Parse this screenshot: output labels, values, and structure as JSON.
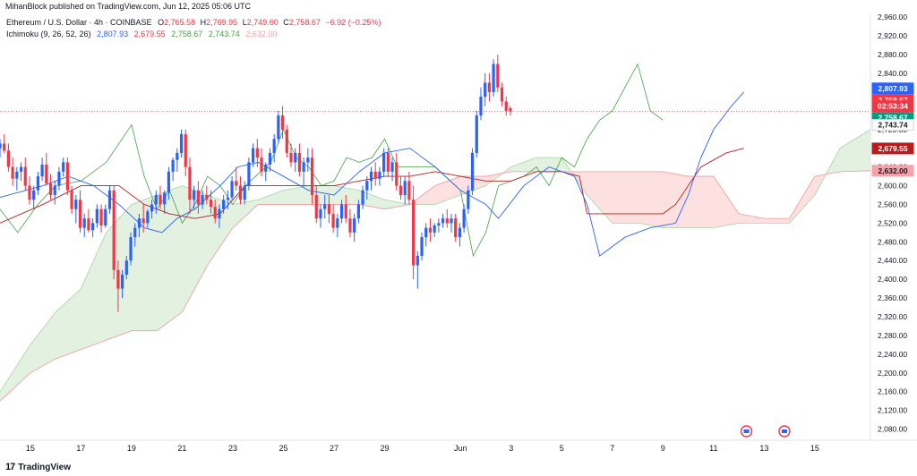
{
  "header": {
    "publisher": "MihanBlock published on TradingView.com, Jun 12, 2025 05:06 UTC"
  },
  "legend": {
    "symbol": "Ethereum / U.S. Dollar · 4h · COINBASE",
    "o_label": "O",
    "o_value": "2,765.58",
    "h_label": "H",
    "h_value": "2,769.95",
    "l_label": "L",
    "l_value": "2,749.60",
    "c_label": "C",
    "c_value": "2,758.67",
    "change": "−6.92 (−0.25%)",
    "ichimoku_label": "Ichimoku (9, 26, 52, 26)",
    "ichimoku_values": [
      "2,807.93",
      "2,679.55",
      "2,758.67",
      "2,743.74",
      "2,632.00"
    ]
  },
  "footer": {
    "brand": "TradingView"
  },
  "colors": {
    "up": "#2962ff",
    "down": "#f23645",
    "conversion": "#2962ff",
    "base": "#b71c1c",
    "lagging": "#43a047",
    "cloud_bull": "#e2f1e0",
    "cloud_bear": "#fce1e0"
  },
  "chart_data": {
    "type": "candlestick",
    "timeframe": "4h",
    "y_axis": {
      "min": 2060,
      "max": 2970,
      "ticks": [
        "2,080.00",
        "2,120.00",
        "2,160.00",
        "2,200.00",
        "2,240.00",
        "2,280.00",
        "2,320.00",
        "2,360.00",
        "2,400.00",
        "2,440.00",
        "2,480.00",
        "2,520.00",
        "2,560.00",
        "2,600.00",
        "2,640.00",
        "2,680.00",
        "2,720.00",
        "2,760.00",
        "2,800.00",
        "2,840.00",
        "2,880.00",
        "2,920.00",
        "2,960.00"
      ],
      "tick_values": [
        2080,
        2120,
        2160,
        2200,
        2240,
        2280,
        2320,
        2360,
        2400,
        2440,
        2480,
        2520,
        2560,
        2600,
        2640,
        2680,
        2720,
        2760,
        2800,
        2840,
        2880,
        2920,
        2960
      ]
    },
    "x_axis": {
      "labels": [
        "15",
        "17",
        "19",
        "21",
        "23",
        "25",
        "27",
        "29",
        "Jun",
        "3",
        "5",
        "7",
        "9",
        "11",
        "13",
        "15"
      ],
      "label_days": [
        0,
        2,
        4,
        6,
        8,
        10,
        12,
        14,
        17,
        19,
        21,
        23,
        25,
        27,
        29,
        31
      ],
      "start_day": -1.2,
      "end_day": 33.2
    },
    "price_tags": [
      {
        "text": "2,807.93",
        "value": 2807.93,
        "color": "#2962ff"
      },
      {
        "text": "2,758.67",
        "value": 2783,
        "color": "#f23645"
      },
      {
        "text": "02:53:34",
        "value": 2770,
        "color": "#f23645"
      },
      {
        "text": "2,758.67",
        "value": 2745,
        "color": "#089981"
      },
      {
        "text": "2,743.74",
        "value": 2730,
        "color": "#ffffff",
        "text_color": "#131722"
      },
      {
        "text": "2,679.55",
        "value": 2679.55,
        "color": "#b71c1c"
      },
      {
        "text": "2,632.00",
        "value": 2632,
        "color": "#f7a1a8",
        "text_color": "#131722"
      }
    ],
    "last_price": 2758.67,
    "candles_start_day": -1.2,
    "candles_step": 0.1667,
    "candles": [
      [
        2680,
        2700,
        2660,
        2690
      ],
      [
        2690,
        2710,
        2670,
        2675
      ],
      [
        2675,
        2690,
        2630,
        2640
      ],
      [
        2640,
        2660,
        2600,
        2615
      ],
      [
        2615,
        2640,
        2590,
        2630
      ],
      [
        2630,
        2650,
        2610,
        2640
      ],
      [
        2640,
        2660,
        2590,
        2600
      ],
      [
        2600,
        2620,
        2560,
        2570
      ],
      [
        2570,
        2600,
        2550,
        2590
      ],
      [
        2590,
        2630,
        2580,
        2620
      ],
      [
        2620,
        2660,
        2610,
        2645
      ],
      [
        2645,
        2670,
        2600,
        2605
      ],
      [
        2605,
        2625,
        2570,
        2580
      ],
      [
        2580,
        2610,
        2560,
        2600
      ],
      [
        2600,
        2640,
        2590,
        2630
      ],
      [
        2630,
        2660,
        2620,
        2650
      ],
      [
        2650,
        2660,
        2580,
        2590
      ],
      [
        2590,
        2600,
        2540,
        2550
      ],
      [
        2550,
        2580,
        2520,
        2570
      ],
      [
        2570,
        2590,
        2500,
        2510
      ],
      [
        2510,
        2540,
        2490,
        2530
      ],
      [
        2530,
        2550,
        2500,
        2505
      ],
      [
        2505,
        2530,
        2490,
        2520
      ],
      [
        2520,
        2560,
        2510,
        2550
      ],
      [
        2550,
        2560,
        2500,
        2515
      ],
      [
        2515,
        2560,
        2510,
        2550
      ],
      [
        2550,
        2600,
        2540,
        2590
      ],
      [
        2590,
        2600,
        2400,
        2420
      ],
      [
        2420,
        2440,
        2330,
        2380
      ],
      [
        2380,
        2420,
        2360,
        2410
      ],
      [
        2410,
        2450,
        2400,
        2440
      ],
      [
        2440,
        2500,
        2430,
        2490
      ],
      [
        2490,
        2520,
        2470,
        2510
      ],
      [
        2510,
        2540,
        2490,
        2530
      ],
      [
        2530,
        2560,
        2500,
        2520
      ],
      [
        2520,
        2550,
        2510,
        2545
      ],
      [
        2545,
        2570,
        2530,
        2560
      ],
      [
        2560,
        2590,
        2540,
        2580
      ],
      [
        2580,
        2600,
        2550,
        2560
      ],
      [
        2560,
        2590,
        2540,
        2585
      ],
      [
        2585,
        2640,
        2570,
        2630
      ],
      [
        2630,
        2660,
        2610,
        2655
      ],
      [
        2655,
        2680,
        2630,
        2670
      ],
      [
        2670,
        2720,
        2660,
        2710
      ],
      [
        2710,
        2720,
        2620,
        2640
      ],
      [
        2640,
        2660,
        2540,
        2570
      ],
      [
        2570,
        2600,
        2550,
        2590
      ],
      [
        2590,
        2610,
        2540,
        2560
      ],
      [
        2560,
        2590,
        2550,
        2580
      ],
      [
        2580,
        2600,
        2560,
        2570
      ],
      [
        2570,
        2590,
        2540,
        2555
      ],
      [
        2555,
        2570,
        2520,
        2530
      ],
      [
        2530,
        2560,
        2510,
        2550
      ],
      [
        2550,
        2580,
        2540,
        2570
      ],
      [
        2570,
        2590,
        2550,
        2575
      ],
      [
        2575,
        2620,
        2570,
        2610
      ],
      [
        2610,
        2640,
        2590,
        2600
      ],
      [
        2600,
        2620,
        2560,
        2570
      ],
      [
        2570,
        2610,
        2560,
        2600
      ],
      [
        2600,
        2660,
        2590,
        2650
      ],
      [
        2650,
        2690,
        2640,
        2680
      ],
      [
        2680,
        2700,
        2640,
        2660
      ],
      [
        2660,
        2680,
        2620,
        2630
      ],
      [
        2630,
        2650,
        2610,
        2645
      ],
      [
        2645,
        2680,
        2630,
        2670
      ],
      [
        2670,
        2710,
        2650,
        2700
      ],
      [
        2700,
        2760,
        2690,
        2750
      ],
      [
        2750,
        2770,
        2700,
        2720
      ],
      [
        2720,
        2730,
        2660,
        2670
      ],
      [
        2670,
        2690,
        2640,
        2650
      ],
      [
        2650,
        2680,
        2630,
        2670
      ],
      [
        2670,
        2690,
        2620,
        2630
      ],
      [
        2630,
        2660,
        2600,
        2650
      ],
      [
        2650,
        2680,
        2630,
        2660
      ],
      [
        2660,
        2680,
        2560,
        2580
      ],
      [
        2580,
        2600,
        2520,
        2530
      ],
      [
        2530,
        2560,
        2510,
        2550
      ],
      [
        2550,
        2580,
        2530,
        2560
      ],
      [
        2560,
        2580,
        2520,
        2540
      ],
      [
        2540,
        2560,
        2500,
        2510
      ],
      [
        2510,
        2540,
        2490,
        2530
      ],
      [
        2530,
        2570,
        2520,
        2560
      ],
      [
        2560,
        2580,
        2520,
        2530
      ],
      [
        2530,
        2550,
        2490,
        2500
      ],
      [
        2500,
        2540,
        2480,
        2530
      ],
      [
        2530,
        2570,
        2520,
        2560
      ],
      [
        2560,
        2600,
        2550,
        2590
      ],
      [
        2590,
        2620,
        2570,
        2610
      ],
      [
        2610,
        2640,
        2590,
        2630
      ],
      [
        2630,
        2650,
        2600,
        2615
      ],
      [
        2615,
        2640,
        2600,
        2630
      ],
      [
        2630,
        2680,
        2620,
        2670
      ],
      [
        2670,
        2680,
        2620,
        2630
      ],
      [
        2630,
        2660,
        2610,
        2650
      ],
      [
        2650,
        2670,
        2590,
        2600
      ],
      [
        2600,
        2620,
        2570,
        2580
      ],
      [
        2580,
        2620,
        2560,
        2610
      ],
      [
        2610,
        2630,
        2560,
        2570
      ],
      [
        2570,
        2600,
        2400,
        2430
      ],
      [
        2430,
        2460,
        2380,
        2450
      ],
      [
        2450,
        2500,
        2440,
        2490
      ],
      [
        2490,
        2520,
        2470,
        2510
      ],
      [
        2510,
        2530,
        2480,
        2500
      ],
      [
        2500,
        2520,
        2490,
        2515
      ],
      [
        2515,
        2530,
        2500,
        2520
      ],
      [
        2520,
        2540,
        2510,
        2530
      ],
      [
        2530,
        2550,
        2510,
        2520
      ],
      [
        2520,
        2540,
        2500,
        2530
      ],
      [
        2530,
        2540,
        2480,
        2490
      ],
      [
        2490,
        2520,
        2470,
        2510
      ],
      [
        2510,
        2560,
        2500,
        2550
      ],
      [
        2550,
        2600,
        2540,
        2590
      ],
      [
        2590,
        2680,
        2580,
        2670
      ],
      [
        2670,
        2760,
        2660,
        2750
      ],
      [
        2750,
        2810,
        2740,
        2790
      ],
      [
        2790,
        2840,
        2770,
        2820
      ],
      [
        2820,
        2840,
        2780,
        2800
      ],
      [
        2800,
        2870,
        2790,
        2860
      ],
      [
        2860,
        2880,
        2800,
        2810
      ],
      [
        2810,
        2820,
        2770,
        2780
      ],
      [
        2780,
        2790,
        2750,
        2760
      ],
      [
        2765.58,
        2769.95,
        2749.6,
        2758.67
      ]
    ],
    "conversion_line": [
      [
        -1.2,
        2575
      ],
      [
        0.5,
        2600
      ],
      [
        1.5,
        2620
      ],
      [
        2.5,
        2600
      ],
      [
        3.5,
        2560
      ],
      [
        4.5,
        2510
      ],
      [
        5.2,
        2500
      ],
      [
        5.8,
        2530
      ],
      [
        6.5,
        2550
      ],
      [
        7.5,
        2600
      ],
      [
        8.2,
        2640
      ],
      [
        9,
        2650
      ],
      [
        10,
        2620
      ],
      [
        11,
        2590
      ],
      [
        12,
        2580
      ],
      [
        13,
        2630
      ],
      [
        14,
        2670
      ],
      [
        15,
        2680
      ],
      [
        16,
        2640
      ],
      [
        17,
        2590
      ],
      [
        18,
        2560
      ],
      [
        18.5,
        2530
      ],
      [
        19.5,
        2600
      ],
      [
        20.5,
        2640
      ],
      [
        21.5,
        2620
      ],
      [
        22,
        2560
      ],
      [
        22.5,
        2450
      ],
      [
        23.5,
        2490
      ],
      [
        24.5,
        2510
      ],
      [
        25.5,
        2520
      ],
      [
        26,
        2580
      ],
      [
        26.5,
        2660
      ],
      [
        27,
        2720
      ],
      [
        27.7,
        2770
      ],
      [
        28.2,
        2800
      ]
    ],
    "base_line": [
      [
        -1.2,
        2520
      ],
      [
        0.5,
        2560
      ],
      [
        2,
        2600
      ],
      [
        3.5,
        2600
      ],
      [
        4.5,
        2560
      ],
      [
        5.5,
        2540
      ],
      [
        6.5,
        2530
      ],
      [
        7.5,
        2540
      ],
      [
        8.5,
        2600
      ],
      [
        10,
        2600
      ],
      [
        11,
        2600
      ],
      [
        12,
        2600
      ],
      [
        13,
        2610
      ],
      [
        14,
        2620
      ],
      [
        15,
        2620
      ],
      [
        16,
        2630
      ],
      [
        17,
        2620
      ],
      [
        18,
        2610
      ],
      [
        19,
        2610
      ],
      [
        20,
        2630
      ],
      [
        21,
        2630
      ],
      [
        21.7,
        2620
      ],
      [
        22,
        2540
      ],
      [
        23,
        2540
      ],
      [
        24,
        2540
      ],
      [
        25,
        2540
      ],
      [
        25.5,
        2560
      ],
      [
        26,
        2600
      ],
      [
        26.5,
        2640
      ],
      [
        27.5,
        2670
      ],
      [
        28.2,
        2680
      ]
    ],
    "lagging_span": [
      [
        -1.2,
        2550
      ],
      [
        -0.5,
        2500
      ],
      [
        0.3,
        2560
      ],
      [
        1,
        2600
      ],
      [
        2,
        2610
      ],
      [
        3,
        2650
      ],
      [
        3.5,
        2690
      ],
      [
        4,
        2730
      ],
      [
        4.5,
        2620
      ],
      [
        5,
        2550
      ],
      [
        5.5,
        2590
      ],
      [
        6,
        2520
      ],
      [
        6.5,
        2560
      ],
      [
        7,
        2620
      ],
      [
        7.5,
        2600
      ],
      [
        8,
        2560
      ],
      [
        8.5,
        2600
      ],
      [
        9.5,
        2650
      ],
      [
        10,
        2720
      ],
      [
        10.5,
        2660
      ],
      [
        11,
        2640
      ],
      [
        11.5,
        2600
      ],
      [
        12,
        2610
      ],
      [
        12.5,
        2660
      ],
      [
        13,
        2650
      ],
      [
        13.5,
        2660
      ],
      [
        14,
        2700
      ],
      [
        14.5,
        2640
      ],
      [
        15,
        2640
      ],
      [
        16,
        2640
      ],
      [
        17,
        2590
      ],
      [
        17.5,
        2450
      ],
      [
        18,
        2500
      ],
      [
        18.5,
        2600
      ],
      [
        19.5,
        2620
      ],
      [
        20,
        2640
      ],
      [
        20.5,
        2600
      ],
      [
        21,
        2660
      ],
      [
        21.5,
        2640
      ],
      [
        22,
        2700
      ],
      [
        22.5,
        2740
      ],
      [
        23,
        2760
      ],
      [
        23.5,
        2810
      ],
      [
        24,
        2860
      ],
      [
        24.5,
        2760
      ],
      [
        25,
        2740
      ]
    ],
    "span_a": [
      [
        -1.2,
        2160
      ],
      [
        0,
        2260
      ],
      [
        1,
        2330
      ],
      [
        2,
        2380
      ],
      [
        3,
        2500
      ],
      [
        4,
        2560
      ],
      [
        5,
        2580
      ],
      [
        6,
        2600
      ],
      [
        7,
        2580
      ],
      [
        8,
        2560
      ],
      [
        9,
        2570
      ],
      [
        10,
        2590
      ],
      [
        11,
        2600
      ],
      [
        12,
        2600
      ],
      [
        13,
        2590
      ],
      [
        14,
        2570
      ],
      [
        15,
        2560
      ],
      [
        16,
        2560
      ],
      [
        17,
        2580
      ],
      [
        18,
        2600
      ],
      [
        19,
        2640
      ],
      [
        20,
        2660
      ],
      [
        21,
        2660
      ],
      [
        22,
        2580
      ],
      [
        23,
        2520
      ],
      [
        24,
        2520
      ],
      [
        25,
        2510
      ],
      [
        26,
        2510
      ],
      [
        27,
        2510
      ],
      [
        28,
        2520
      ],
      [
        29,
        2520
      ],
      [
        30,
        2520
      ],
      [
        31,
        2580
      ],
      [
        32,
        2680
      ],
      [
        33.2,
        2720
      ]
    ],
    "span_b": [
      [
        -1.2,
        2140
      ],
      [
        0,
        2200
      ],
      [
        1,
        2230
      ],
      [
        2,
        2250
      ],
      [
        3,
        2270
      ],
      [
        4,
        2290
      ],
      [
        5,
        2290
      ],
      [
        6,
        2330
      ],
      [
        7,
        2430
      ],
      [
        8,
        2510
      ],
      [
        9,
        2560
      ],
      [
        10,
        2560
      ],
      [
        11,
        2560
      ],
      [
        12,
        2560
      ],
      [
        13,
        2560
      ],
      [
        14,
        2550
      ],
      [
        15,
        2560
      ],
      [
        16,
        2600
      ],
      [
        17,
        2620
      ],
      [
        18,
        2620
      ],
      [
        19,
        2630
      ],
      [
        20,
        2630
      ],
      [
        21,
        2630
      ],
      [
        22,
        2630
      ],
      [
        23,
        2630
      ],
      [
        24,
        2630
      ],
      [
        25,
        2630
      ],
      [
        26,
        2620
      ],
      [
        27,
        2620
      ],
      [
        28,
        2540
      ],
      [
        29,
        2530
      ],
      [
        30,
        2530
      ],
      [
        31,
        2620
      ],
      [
        32,
        2630
      ],
      [
        33.2,
        2632
      ]
    ]
  }
}
